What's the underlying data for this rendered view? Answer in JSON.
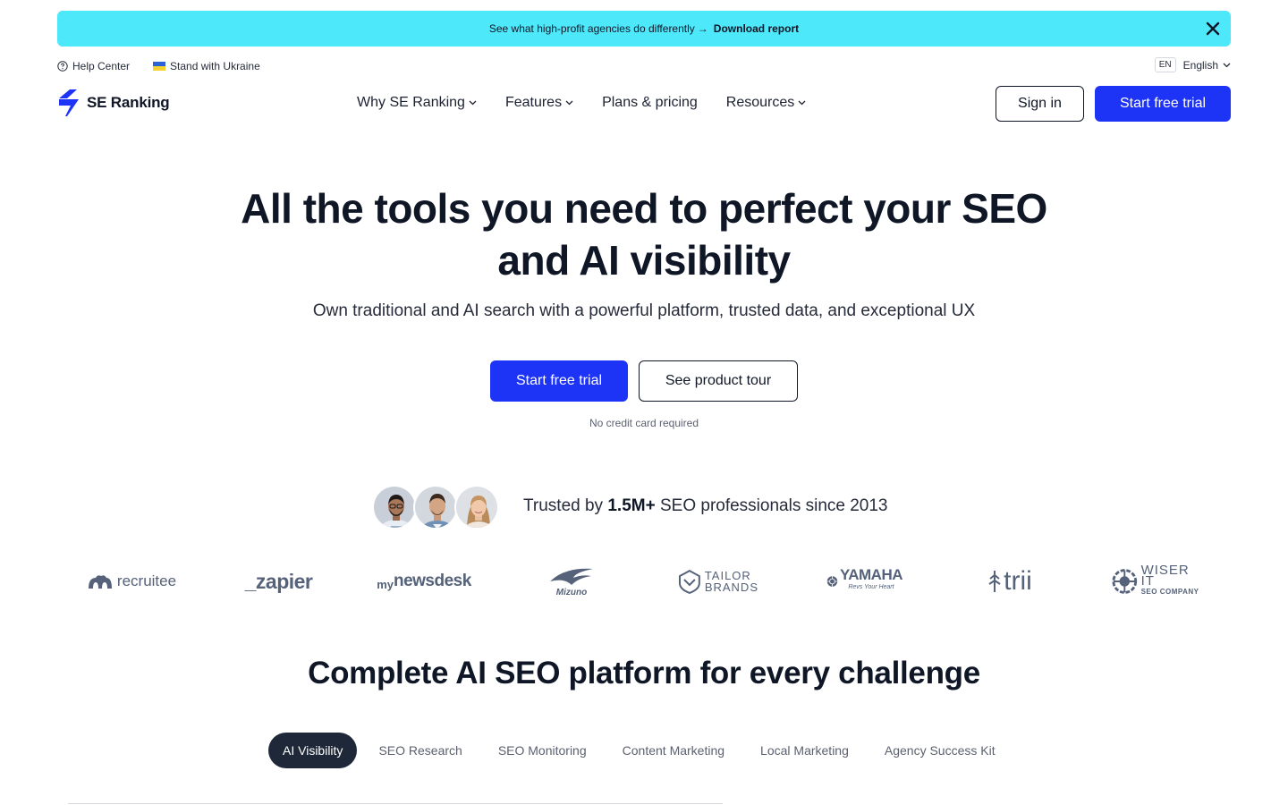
{
  "promo": {
    "text": "See what high-profit agencies do differently",
    "arrow": "→",
    "link": "Download report",
    "bg_color": "#4ee8fb"
  },
  "utility": {
    "help_center": "Help Center",
    "ukraine": "Stand with Ukraine",
    "lang_code": "EN",
    "lang_name": "English"
  },
  "nav": {
    "brand": "SE Ranking",
    "menu": [
      {
        "label": "Why SE Ranking",
        "dropdown": true
      },
      {
        "label": "Features",
        "dropdown": true
      },
      {
        "label": "Plans & pricing",
        "dropdown": false
      },
      {
        "label": "Resources",
        "dropdown": true
      }
    ],
    "sign_in": "Sign in",
    "start_trial": "Start free trial",
    "accent_color": "#1d33f5"
  },
  "hero": {
    "title_line1": "All the tools you need to perfect your SEO",
    "title_line2": "and AI visibility",
    "subtitle": "Own traditional and AI search with a powerful platform, trusted data, and exceptional UX",
    "primary_cta": "Start free trial",
    "secondary_cta": "See product tour",
    "note": "No credit card required"
  },
  "trusted": {
    "prefix": "Trusted by",
    "count": "1.5M+",
    "suffix": "SEO professionals since 2013"
  },
  "logos": {
    "recruitee": "recruitee",
    "zapier": "_zapier",
    "newsdesk_my": "my",
    "newsdesk": "newsdesk",
    "mizuno": "Mizuno",
    "tailor_1": "TAILOR",
    "tailor_2": "BRANDS",
    "yamaha": "YAMAHA",
    "yamaha_tag": "Revs Your Heart",
    "trii": "trii",
    "wiser_1": "WISER IT",
    "wiser_2": "SEO COMPANY"
  },
  "section": {
    "title": "Complete AI SEO platform for every challenge",
    "tabs": [
      {
        "label": "AI Visibility",
        "active": true
      },
      {
        "label": "SEO Research",
        "active": false
      },
      {
        "label": "SEO Monitoring",
        "active": false
      },
      {
        "label": "Content Marketing",
        "active": false
      },
      {
        "label": "Local Marketing",
        "active": false
      },
      {
        "label": "Agency Success Kit",
        "active": false
      }
    ]
  }
}
